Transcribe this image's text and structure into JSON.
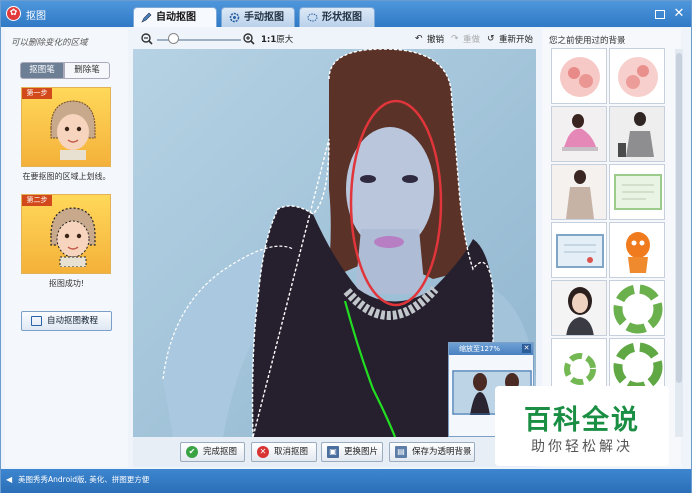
{
  "window": {
    "title": "抠图",
    "tabs": [
      {
        "label": "自动抠图",
        "active": true
      },
      {
        "label": "手动抠图",
        "active": false
      },
      {
        "label": "形状抠图",
        "active": false
      }
    ]
  },
  "left_panel": {
    "hint": "可以删除变化的区域",
    "mode_brush": "抠图笔",
    "mode_eraser": "删除笔",
    "step1_tag": "第一步",
    "step1_caption": "在要抠图的区域上划线。",
    "step2_tag": "第二步",
    "step2_caption": "抠图成功!",
    "tutorial_button": "自动抠图教程"
  },
  "toolbar": {
    "original_size_bold": "1:1",
    "original_size_label": "原大",
    "zoom_level": 0.2,
    "undo": "撤销",
    "redo": "重做",
    "restart": "重新开始"
  },
  "zoom_popup": {
    "label": "缩放至127%"
  },
  "bottom_bar": {
    "done": "完成抠图",
    "cancel": "取消抠图",
    "change_image": "更换图片",
    "save_transparent": "保存为透明背景"
  },
  "right_panel": {
    "title": "您之前使用过的背景"
  },
  "watermark": {
    "main": "百科全说",
    "sub": "助你轻松解决"
  },
  "statusbar": {
    "text": "美图秀秀Android版, 美化、拼图更方便"
  },
  "colors": {
    "titlebar": "#2f79c6",
    "selection_ellipse": "#e0353a",
    "brush_stroke": "#22dd22",
    "watermark_green": "#1a8e43"
  }
}
